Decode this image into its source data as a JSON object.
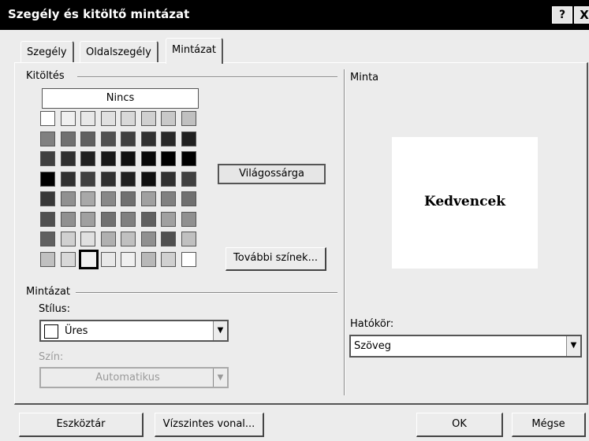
{
  "window": {
    "title": "Szegély és kitöltő mintázat",
    "help_label": "?",
    "close_label": "X"
  },
  "tabs": [
    {
      "label": "Szegély",
      "active": false
    },
    {
      "label": "Oldalszegély",
      "active": false
    },
    {
      "label": "Mintázat",
      "active": true
    }
  ],
  "fill": {
    "group_label": "Kitöltés",
    "none_label": "Nincs",
    "selected_color_name": "Világossárga",
    "more_colors_label": "További színek...",
    "palette_rows": [
      [
        "#ffffff",
        "#f0f0f0",
        "#e8e8e8",
        "#e0e0e0",
        "#d8d8d8",
        "#d0d0d0",
        "#c8c8c8",
        "#c0c0c0"
      ],
      [
        "#808080",
        "#707070",
        "#606060",
        "#505050",
        "#404040",
        "#303030",
        "#282828",
        "#202020"
      ],
      [
        "#404040",
        "#303030",
        "#202020",
        "#181818",
        "#101010",
        "#080808",
        "#000000",
        "#000000"
      ],
      [
        "#000000",
        "#303030",
        "#404040",
        "#303030",
        "#202020",
        "#101010",
        "#303030",
        "#404040"
      ],
      [
        "#383838",
        "#909090",
        "#a8a8a8",
        "#888888",
        "#707070",
        "#a0a0a0",
        "#808080",
        "#707070"
      ],
      [
        "#505050",
        "#909090",
        "#a0a0a0",
        "#707070",
        "#808080",
        "#606060",
        "#a0a0a0",
        "#909090"
      ],
      [
        "#606060",
        "#d0d0d0",
        "#e0e0e0",
        "#b0b0b0",
        "#c0c0c0",
        "#909090",
        "#505050",
        "#c0c0c0"
      ],
      [
        "#c0c0c0",
        "#d8d8d8",
        "#f0f0f0",
        "#e8e8e8",
        "#f0f0f0",
        "#b8b8b8",
        "#d0d0d0",
        "#ffffff"
      ]
    ]
  },
  "pattern": {
    "group_label": "Mintázat",
    "style_label": "Stílus:",
    "style_value": "Üres",
    "color_label": "Szín:",
    "color_value": "Automatikus"
  },
  "preview": {
    "group_label": "Minta",
    "sample_text": "Kedvencek",
    "scope_label": "Hatókör:",
    "scope_value": "Szöveg"
  },
  "buttons": {
    "toolbar": "Eszköztár",
    "horizontal_line": "Vízszintes vonal...",
    "ok": "OK",
    "cancel": "Mégse"
  }
}
